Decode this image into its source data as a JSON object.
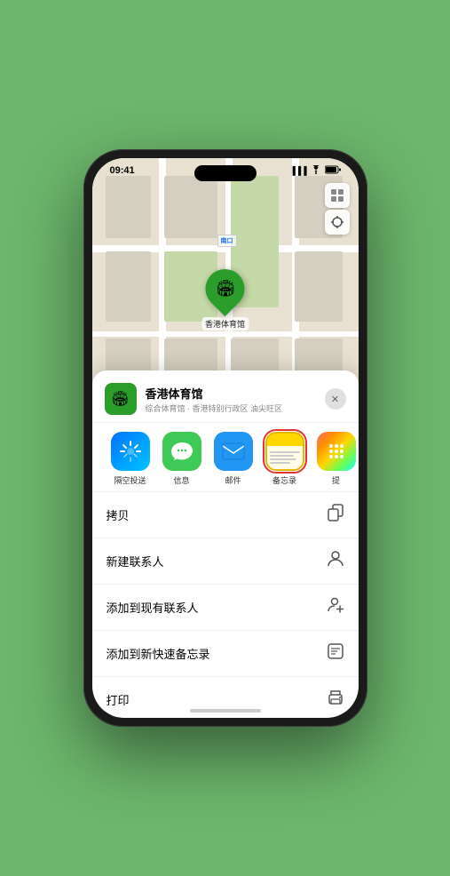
{
  "status_bar": {
    "time": "09:41",
    "signal": "▋▋▋",
    "wifi": "WiFi",
    "battery": "Battery"
  },
  "map": {
    "label_south_entrance": "南口",
    "controls": {
      "map_type": "🗺",
      "location": "⤢"
    },
    "stadium_label": "香港体育馆"
  },
  "bottom_sheet": {
    "venue_icon": "🏟",
    "venue_name": "香港体育馆",
    "venue_subtitle": "综合体育馆 · 香港特别行政区 油尖旺区",
    "close_label": "✕",
    "share_apps": [
      {
        "id": "airdrop",
        "label": "隔空投送"
      },
      {
        "id": "messages",
        "label": "信息"
      },
      {
        "id": "mail",
        "label": "邮件"
      },
      {
        "id": "notes",
        "label": "备忘录",
        "selected": true
      },
      {
        "id": "more",
        "label": "提"
      }
    ],
    "actions": [
      {
        "id": "copy",
        "label": "拷贝",
        "icon": "⎘"
      },
      {
        "id": "new-contact",
        "label": "新建联系人",
        "icon": "👤"
      },
      {
        "id": "add-existing",
        "label": "添加到现有联系人",
        "icon": "👤+"
      },
      {
        "id": "add-notes",
        "label": "添加到新快速备忘录",
        "icon": "📋"
      },
      {
        "id": "print",
        "label": "打印",
        "icon": "🖨"
      }
    ]
  }
}
